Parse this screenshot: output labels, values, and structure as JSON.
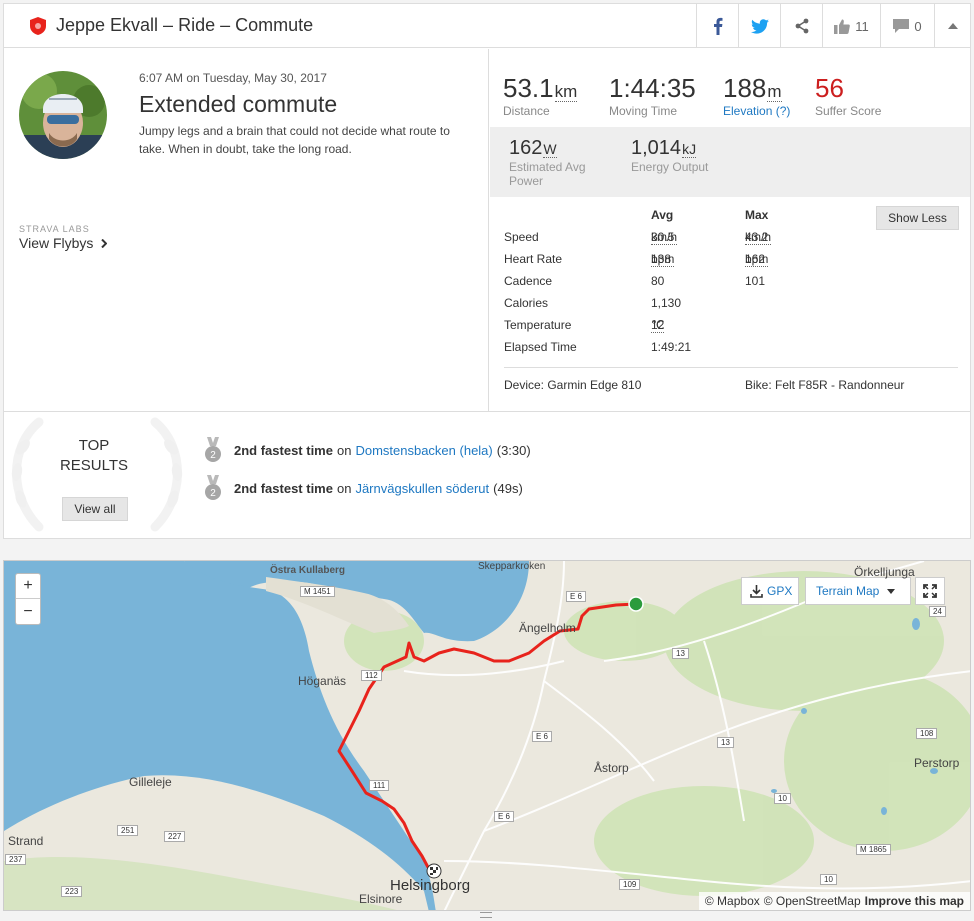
{
  "header": {
    "title": "Jeppe Ekvall – Ride – Commute",
    "kudos_count": "11",
    "comment_count": "0"
  },
  "activity": {
    "date": "6:07 AM on Tuesday, May 30, 2017",
    "title": "Extended commute",
    "description": "Jumpy legs and a brain that could not decide what route to take. When in doubt, take the long road.",
    "labs_label": "STRAVA LABS",
    "flyby_label": "View Flybys"
  },
  "stats": {
    "distance": {
      "value": "53.1",
      "unit": "km",
      "label": "Distance"
    },
    "moving_time": {
      "value": "1:44:35",
      "label": "Moving Time"
    },
    "elevation": {
      "value": "188",
      "unit": "m",
      "label": "Elevation (?)"
    },
    "suffer": {
      "value": "56",
      "label": "Suffer Score"
    },
    "power": {
      "value": "162",
      "unit": "W",
      "label": "Estimated Avg Power"
    },
    "energy": {
      "value": "1,014",
      "unit": "kJ",
      "label": "Energy Output"
    }
  },
  "table": {
    "avg_header": "Avg",
    "max_header": "Max",
    "show_less": "Show Less",
    "rows": [
      {
        "label": "Speed",
        "avg": "30.5",
        "avg_unit": "km/h",
        "max": "43.2",
        "max_unit": "km/h"
      },
      {
        "label": "Heart Rate",
        "avg": "138",
        "avg_unit": "bpm",
        "max": "162",
        "max_unit": "bpm"
      },
      {
        "label": "Cadence",
        "avg": "80",
        "avg_unit": "",
        "max": "101",
        "max_unit": ""
      },
      {
        "label": "Calories",
        "avg": "1,130",
        "avg_unit": "",
        "max": "",
        "max_unit": ""
      },
      {
        "label": "Temperature",
        "avg": "12",
        "avg_unit": "℃",
        "max": "",
        "max_unit": ""
      },
      {
        "label": "Elapsed Time",
        "avg": "1:49:21",
        "avg_unit": "",
        "max": "",
        "max_unit": ""
      }
    ],
    "device": "Device: Garmin Edge 810",
    "bike": "Bike: Felt F85R - Randonneur"
  },
  "results": {
    "heading_line1": "TOP",
    "heading_line2": "RESULTS",
    "view_all": "View all",
    "items": [
      {
        "medal": "2",
        "rank": "2nd fastest time",
        "on": "on",
        "segment": "Domstensbacken (hela)",
        "time": "(3:30)"
      },
      {
        "medal": "2",
        "rank": "2nd fastest time",
        "on": "on",
        "segment": "Järnvägskullen söderut",
        "time": "(49s)"
      }
    ]
  },
  "map": {
    "zoom_in": "+",
    "zoom_out": "−",
    "gpx_label": "GPX",
    "terrain_label": "Terrain Map",
    "attribution_mapbox": "© Mapbox",
    "attribution_osm": "© OpenStreetMap",
    "improve": "Improve this map",
    "places": {
      "ostra": "Östra Kullaberg",
      "skepparkroken": "Skepparkroken",
      "orkelljunga": "Örkelljunga",
      "angelholm": "Ängelholm",
      "hoganas": "Höganäs",
      "astorp": "Åstorp",
      "perstorp": "Perstorp",
      "gilleleje": "Gilleleje",
      "strand": "Strand",
      "helsingborg": "Helsingborg",
      "elsinore": "Elsinore"
    },
    "roads": [
      "M 1451",
      "E 6",
      "24",
      "13",
      "112",
      "E 6",
      "13",
      "108",
      "111",
      "251",
      "227",
      "237",
      "223",
      "109",
      "M 1865",
      "10",
      "E 6",
      "10"
    ],
    "colors": {
      "route": "#e8231c",
      "water": "#79b4d8",
      "land": "#ebe8de",
      "green": "#cfe3b6"
    }
  },
  "colors": {
    "link": "#1e78c2",
    "suffer": "#cc1f1f"
  }
}
